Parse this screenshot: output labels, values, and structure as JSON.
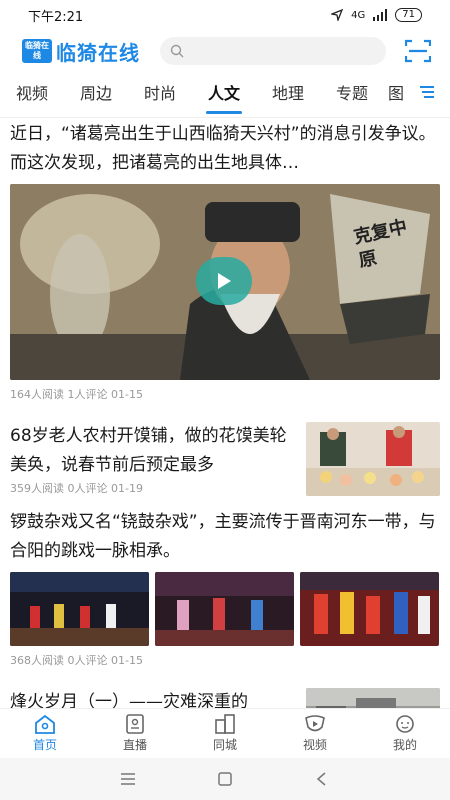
{
  "status": {
    "time": "下午2:21",
    "network": "4G",
    "battery": "71"
  },
  "header": {
    "logo_badge": "临猗在线",
    "logo_text": "临猗在线",
    "search_placeholder": ""
  },
  "tabs": [
    {
      "label": "视频"
    },
    {
      "label": "周边"
    },
    {
      "label": "时尚"
    },
    {
      "label": "人文"
    },
    {
      "label": "地理"
    },
    {
      "label": "专题"
    },
    {
      "label": "图"
    }
  ],
  "articles": [
    {
      "title": "近日，“诸葛亮出生于山西临猗天兴村”的消息引发争议。而这次发现，把诸葛亮的出生地具体…",
      "meta": "164人阅读 1人评论 01-15",
      "banner_text": "克复中原"
    },
    {
      "title": "68岁老人农村开馍铺，做的花馍美轮美奂，说春节前后预定最多",
      "meta": "359人阅读 0人评论 01-19"
    },
    {
      "title": "锣鼓杂戏又名“铙鼓杂戏”，主要流传于晋南河东一带，与合阳的跳戏一脉相承。",
      "meta": "368人阅读 0人评论 01-15"
    },
    {
      "title": "烽火岁月（一）——灾难深重的"
    }
  ],
  "bottom_nav": [
    {
      "label": "首页"
    },
    {
      "label": "直播"
    },
    {
      "label": "同城"
    },
    {
      "label": "视频"
    },
    {
      "label": "我的"
    }
  ],
  "colors": {
    "accent": "#1e88e5",
    "play": "#28aaa0"
  }
}
